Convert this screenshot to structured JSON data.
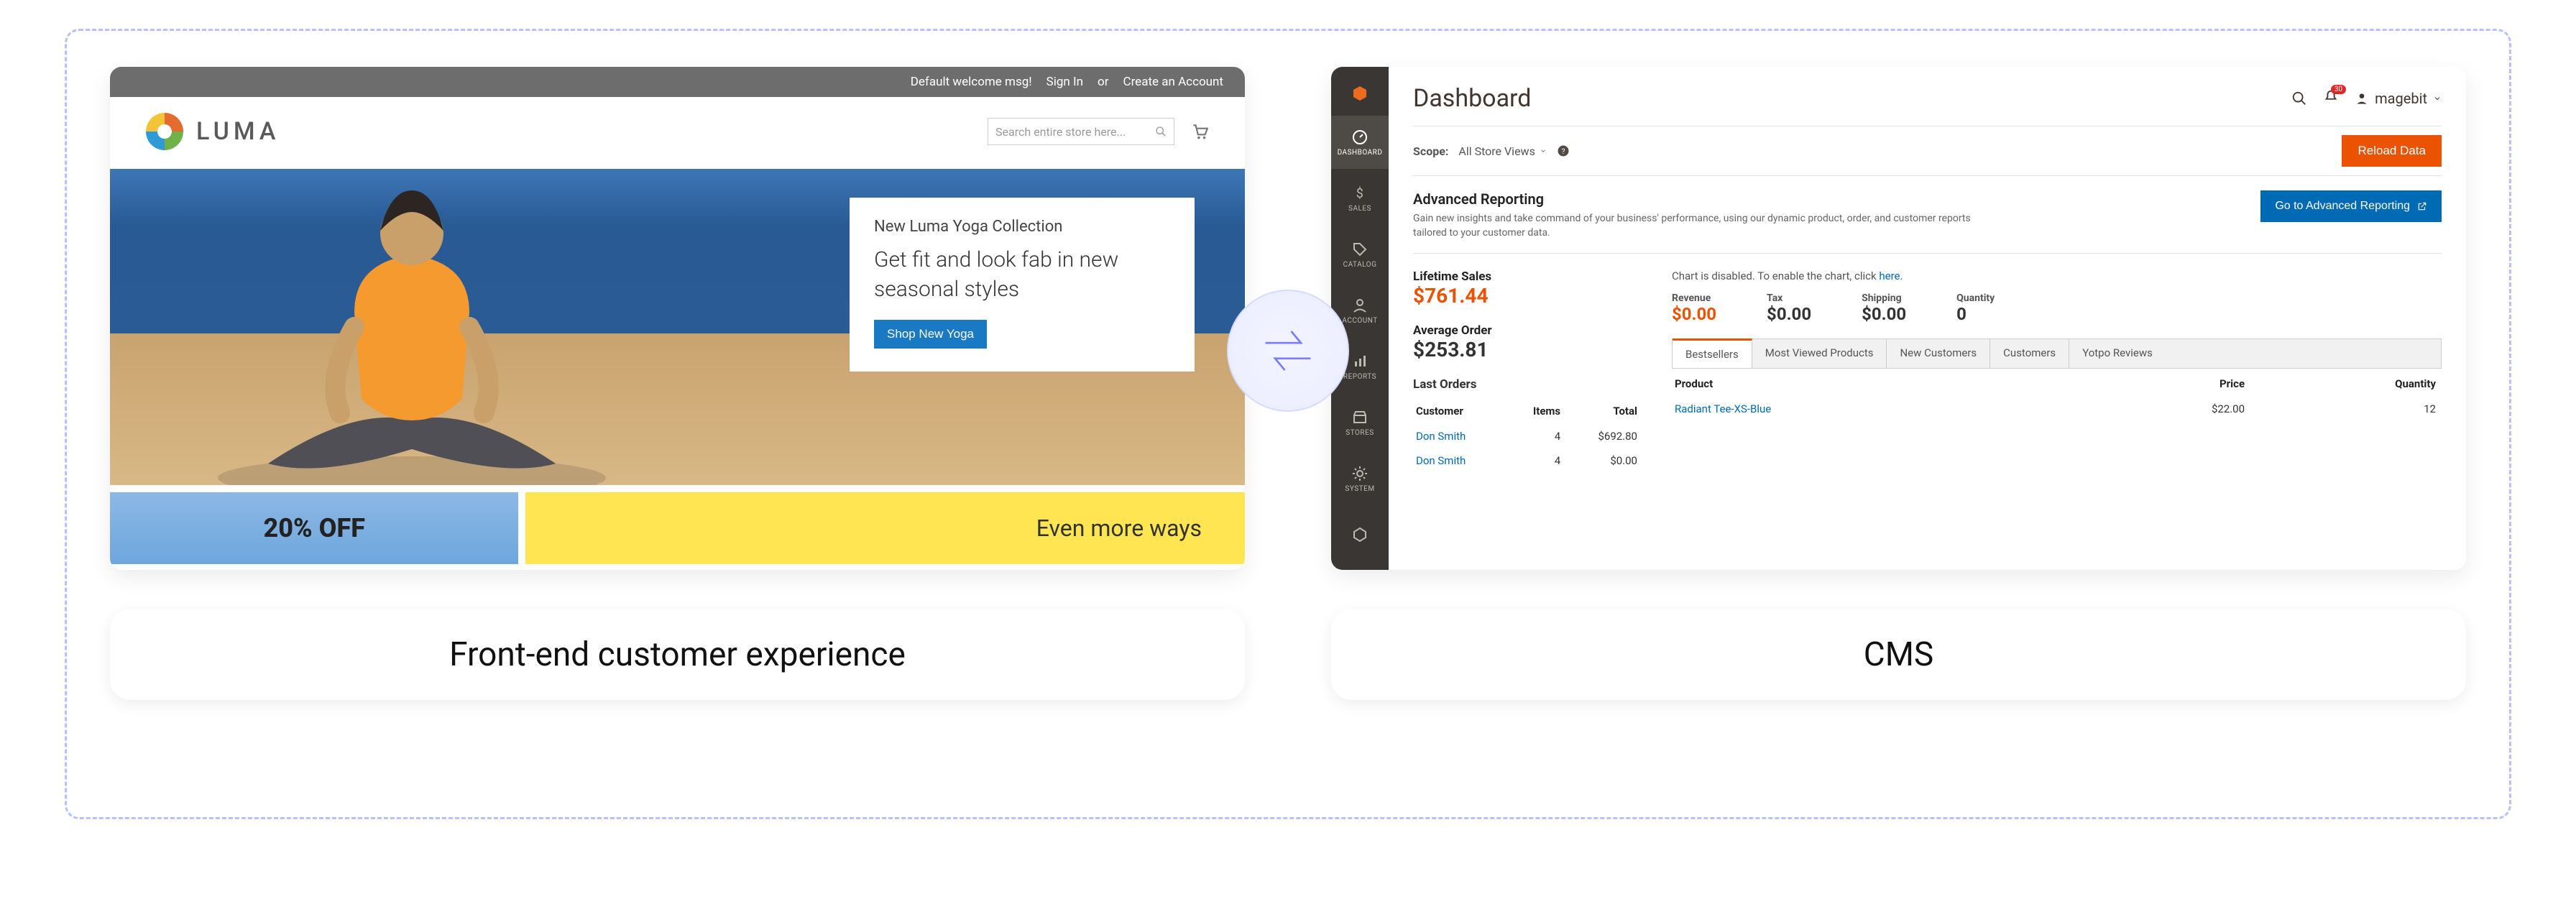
{
  "labels": {
    "left": "Front-end customer experience",
    "right": "CMS"
  },
  "storefront": {
    "topbar": {
      "welcome": "Default welcome msg!",
      "signin": "Sign In",
      "or": "or",
      "create": "Create an Account"
    },
    "brand": "LUMA",
    "search_placeholder": "Search entire store here...",
    "hero": {
      "kicker": "New Luma Yoga Collection",
      "headline": "Get fit and look fab in new seasonal styles",
      "cta": "Shop New Yoga"
    },
    "promo": {
      "left": "20% OFF",
      "right": "Even more ways"
    }
  },
  "admin": {
    "title": "Dashboard",
    "sidebar": [
      {
        "id": "dashboard",
        "label": "DASHBOARD"
      },
      {
        "id": "sales",
        "label": "SALES"
      },
      {
        "id": "catalog",
        "label": "CATALOG"
      },
      {
        "id": "account",
        "label": "ACCOUNT"
      },
      {
        "id": "reports",
        "label": "REPORTS"
      },
      {
        "id": "stores",
        "label": "STORES"
      },
      {
        "id": "system",
        "label": "SYSTEM"
      },
      {
        "id": "partners",
        "label": ""
      }
    ],
    "notifications_count": "30",
    "user": "magebit",
    "scope_label": "Scope:",
    "scope_value": "All Store Views",
    "reload": "Reload Data",
    "adv": {
      "title": "Advanced Reporting",
      "desc": "Gain new insights and take command of your business' performance, using our dynamic product, order, and customer reports tailored to your customer data.",
      "cta": "Go to Advanced Reporting"
    },
    "lifetime_label": "Lifetime Sales",
    "lifetime_value": "$761.44",
    "average_label": "Average Order",
    "average_value": "$253.81",
    "chart_msg_prefix": "Chart is disabled. To enable the chart, click ",
    "chart_msg_link": "here",
    "kpis": [
      {
        "label": "Revenue",
        "value": "$0.00",
        "orange": true
      },
      {
        "label": "Tax",
        "value": "$0.00"
      },
      {
        "label": "Shipping",
        "value": "$0.00"
      },
      {
        "label": "Quantity",
        "value": "0"
      }
    ],
    "tabs": [
      "Bestsellers",
      "Most Viewed Products",
      "New Customers",
      "Customers",
      "Yotpo Reviews"
    ],
    "last_orders": {
      "title": "Last Orders",
      "headers": [
        "Customer",
        "Items",
        "Total"
      ],
      "rows": [
        {
          "customer": "Don Smith",
          "items": "4",
          "total": "$692.80"
        },
        {
          "customer": "Don Smith",
          "items": "4",
          "total": "$0.00"
        }
      ]
    },
    "products": {
      "headers": [
        "Product",
        "Price",
        "Quantity"
      ],
      "rows": [
        {
          "product": "Radiant Tee-XS-Blue",
          "price": "$22.00",
          "qty": "12"
        }
      ]
    }
  }
}
